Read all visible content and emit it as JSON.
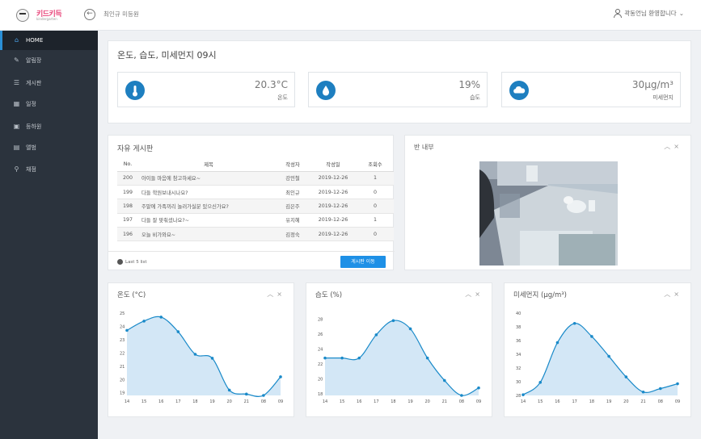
{
  "header": {
    "brand": "키드키득",
    "brand_sub": "kindergarten",
    "breadcrumb": "최인규 미등원",
    "user_greeting": "곽동언님 환영합니다",
    "user_chevron": "⌄"
  },
  "sidebar": {
    "items": [
      {
        "label": "HOME",
        "icon": "home-icon",
        "glyph": "⌂",
        "active": true
      },
      {
        "label": "알림장",
        "icon": "megaphone-icon",
        "glyph": "✎"
      },
      {
        "label": "게시판",
        "icon": "list-icon",
        "glyph": "☰"
      },
      {
        "label": "일정",
        "icon": "calendar-icon",
        "glyph": "▦"
      },
      {
        "label": "등하원",
        "icon": "bus-icon",
        "glyph": "▣"
      },
      {
        "label": "앨범",
        "icon": "album-icon",
        "glyph": "▤"
      },
      {
        "label": "채점",
        "icon": "chart-icon",
        "glyph": "⚲"
      }
    ]
  },
  "env": {
    "title": "온도, 습도, 미세먼지 09시",
    "temp": {
      "value": "20.3°C",
      "label": "온도",
      "icon": "thermometer-icon"
    },
    "humidity": {
      "value": "19%",
      "label": "습도",
      "icon": "water-drop-icon"
    },
    "dust": {
      "value": "30μg/m³",
      "label": "미세먼지",
      "icon": "cloud-icon"
    }
  },
  "board": {
    "title": "자유 게시판",
    "columns": {
      "no": "No.",
      "title": "제목",
      "author": "작성자",
      "date": "작성일",
      "views": "조회수"
    },
    "rows": [
      {
        "no": "200",
        "title": "아이들 마음에 참고하세요~",
        "author": "강민철",
        "date": "2019-12-26",
        "views": "1"
      },
      {
        "no": "199",
        "title": "다들 학원보내시나요?",
        "author": "최인규",
        "date": "2019-12-26",
        "views": "0"
      },
      {
        "no": "198",
        "title": "주말에 가족끼리 놀러가실분 있으신가요?",
        "author": "김은주",
        "date": "2019-12-26",
        "views": "0"
      },
      {
        "no": "197",
        "title": "다들 잘 맞춰셨나요?~",
        "author": "유지혜",
        "date": "2019-12-26",
        "views": "1"
      },
      {
        "no": "196",
        "title": "오늘 비가와요~",
        "author": "김정숙",
        "date": "2019-12-26",
        "views": "0"
      }
    ],
    "footer_note": "Last 5 list",
    "go_button": "게시판 이동"
  },
  "camera": {
    "title": "반 내부",
    "ctrl_up": "︿",
    "ctrl_close": "×"
  },
  "colors": {
    "accent": "#1e7fc0",
    "line": "#1a8ac9",
    "fill": "#d3e7f6",
    "sidebar": "#2b333d"
  },
  "chart_data": [
    {
      "type": "area",
      "title": "온도 (°C)",
      "x": [
        "14",
        "15",
        "16",
        "17",
        "18",
        "19",
        "20",
        "21",
        "08",
        "09"
      ],
      "values": [
        23.7,
        24.4,
        24.7,
        23.6,
        21.9,
        21.6,
        19.2,
        18.9,
        18.8,
        20.2
      ],
      "ylim": [
        18.8,
        25
      ],
      "yticks": [
        "25",
        "24",
        "23",
        "22",
        "21",
        "20",
        "19"
      ]
    },
    {
      "type": "area",
      "title": "습도 (%)",
      "x": [
        "14",
        "15",
        "16",
        "17",
        "18",
        "19",
        "20",
        "21",
        "08",
        "09"
      ],
      "values": [
        22.8,
        22.8,
        22.8,
        25.9,
        27.8,
        26.7,
        22.8,
        19.8,
        17.8,
        18.8
      ],
      "ylim": [
        17.8,
        28.8
      ],
      "yticks": [
        "28",
        "26",
        "24",
        "22",
        "20",
        "18"
      ]
    },
    {
      "type": "area",
      "title": "미세먼지 (μg/m³)",
      "x": [
        "14",
        "15",
        "16",
        "17",
        "18",
        "19",
        "20",
        "21",
        "08",
        "09"
      ],
      "values": [
        28.1,
        29.9,
        35.7,
        38.5,
        36.6,
        33.7,
        30.7,
        28.5,
        29.0,
        29.7
      ],
      "ylim": [
        28,
        40
      ],
      "yticks": [
        "40",
        "38",
        "36",
        "34",
        "32",
        "30",
        "28"
      ]
    }
  ]
}
